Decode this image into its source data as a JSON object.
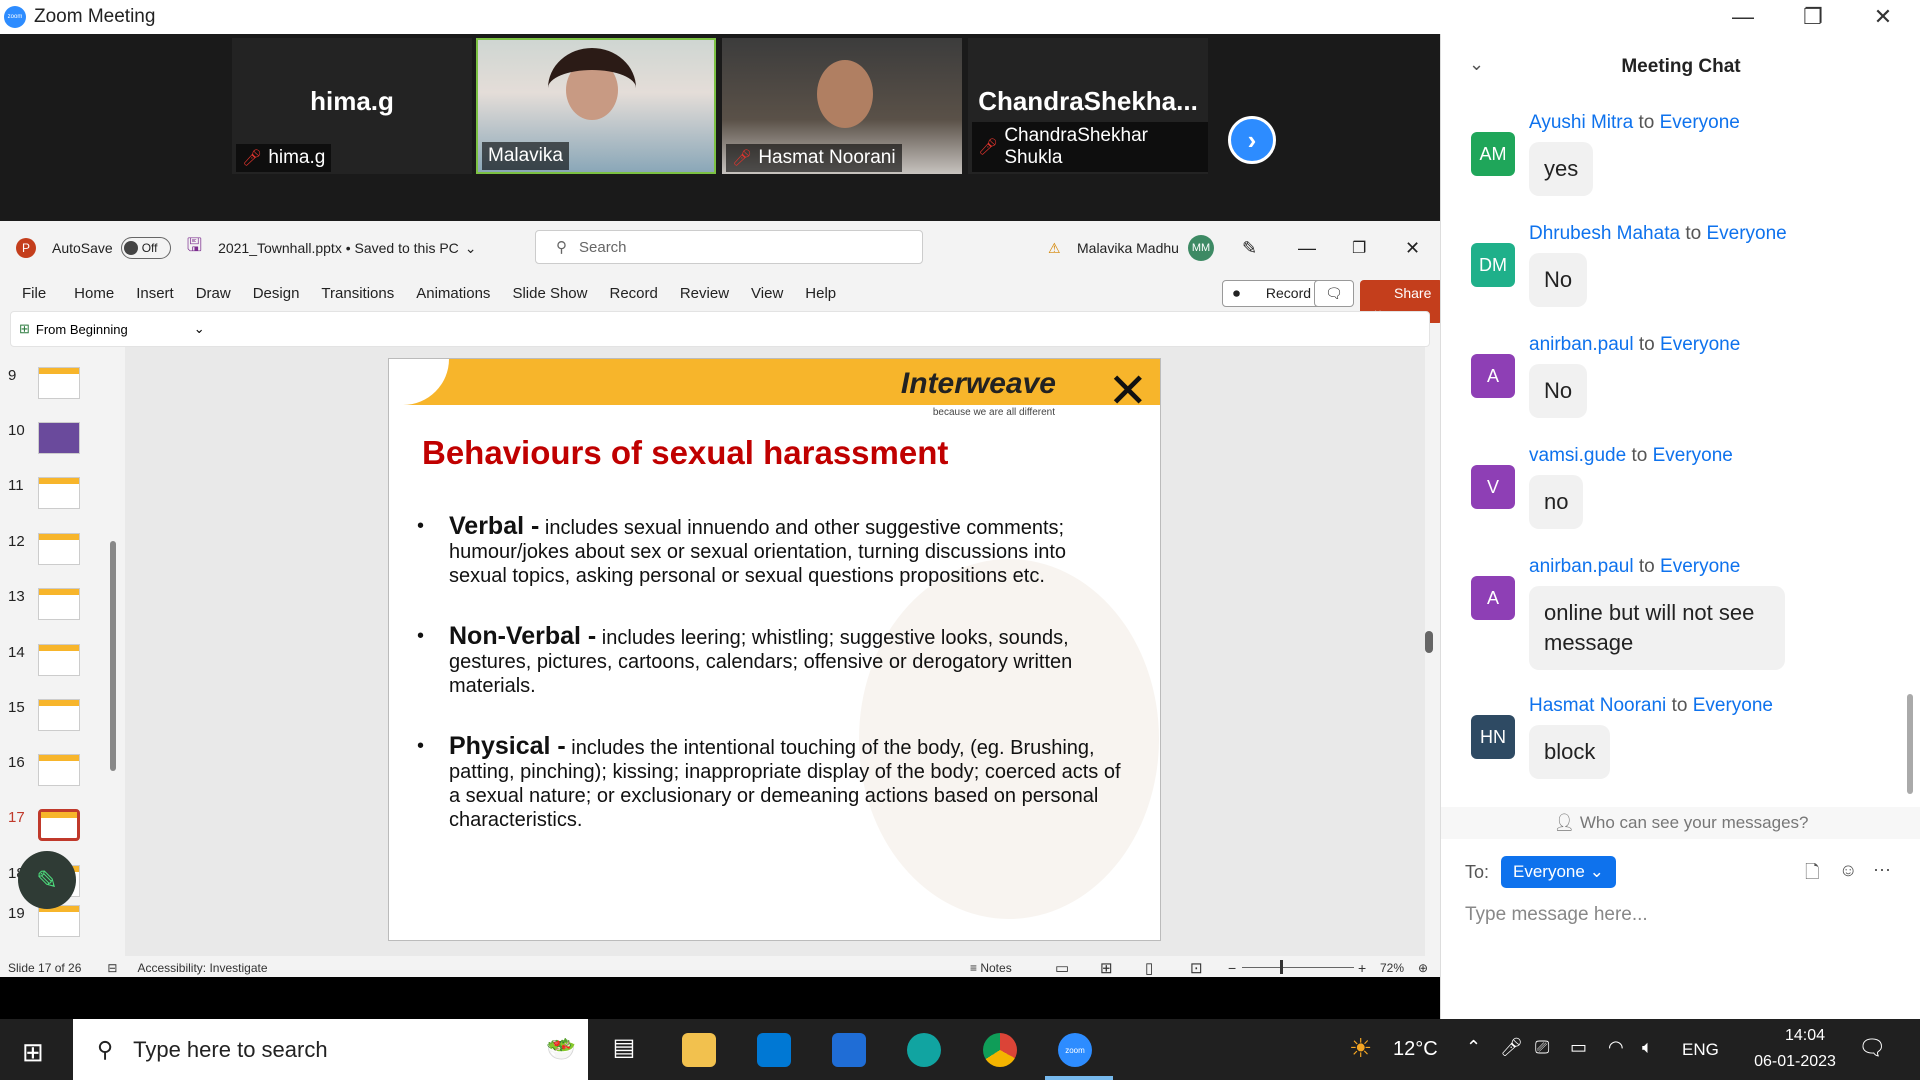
{
  "zoom": {
    "window_title": "Zoom Meeting",
    "participants": [
      {
        "big_name": "hima.g",
        "tag": "hima.g",
        "muted": true
      },
      {
        "big_name": "",
        "tag": "Malavika",
        "muted": false
      },
      {
        "big_name": "",
        "tag": "Hasmat Noorani",
        "muted": true
      },
      {
        "big_name": "ChandraShekha...",
        "tag": "ChandraShekhar Shukla",
        "muted": true
      }
    ]
  },
  "ppt": {
    "autosave_label": "AutoSave",
    "autosave_state": "Off",
    "file_name": "2021_Townhall.pptx • Saved to this PC",
    "search_placeholder": "Search",
    "user_name": "Malavika Madhu",
    "user_initials": "MM",
    "menu": [
      "File",
      "Home",
      "Insert",
      "Draw",
      "Design",
      "Transitions",
      "Animations",
      "Slide Show",
      "Record",
      "Review",
      "View",
      "Help"
    ],
    "record_button": "Record",
    "share_button": "Share",
    "ribbon_from_beginning": "From Beginning",
    "thumbnails": [
      "9",
      "10",
      "11",
      "12",
      "13",
      "14",
      "15",
      "16",
      "17",
      "18",
      "19"
    ],
    "active_slide": "17",
    "status_slide": "Slide 17 of 26",
    "status_accessibility": "Accessibility: Investigate",
    "status_notes": "Notes",
    "zoom_level": "72%",
    "slide": {
      "logo_text": "Interweave",
      "tagline": "because we are all different",
      "title": "Behaviours of sexual harassment",
      "bullets": [
        {
          "term": "Verbal -",
          "text": " includes sexual innuendo and other suggestive comments; humour/jokes about sex or sexual orientation, turning discussions into sexual topics, asking personal or sexual questions propositions etc."
        },
        {
          "term": "Non-Verbal -",
          "text": " includes leering; whistling; suggestive looks, sounds, gestures, pictures, cartoons, calendars; offensive or derogatory written materials."
        },
        {
          "term": "Physical -",
          "text": "  includes the intentional touching of the body, (eg. Brushing, patting, pinching); kissing; inappropriate display of the body; coerced acts of a sexual nature; or exclusionary or demeaning actions based on personal characteristics."
        }
      ]
    }
  },
  "chat": {
    "title": "Meeting Chat",
    "messages": [
      {
        "initials": "AM",
        "color": "#1fa65a",
        "sender": "Ayushi Mitra",
        "to": "to",
        "target": "Everyone",
        "text": "yes"
      },
      {
        "initials": "DM",
        "color": "#1fb08a",
        "sender": "Dhrubesh Mahata",
        "to": "to",
        "target": "Everyone",
        "text": "No"
      },
      {
        "initials": "A",
        "color": "#8e3fb5",
        "sender": "anirban.paul",
        "to": "to",
        "target": "Everyone",
        "text": "No"
      },
      {
        "initials": "V",
        "color": "#8e3fb5",
        "sender": "vamsi.gude",
        "to": "to",
        "target": "Everyone",
        "text": "no"
      },
      {
        "initials": "A",
        "color": "#8e3fb5",
        "sender": "anirban.paul",
        "to": "to",
        "target": "Everyone",
        "text": "online but will not see message"
      },
      {
        "initials": "HN",
        "color": "#2e4a63",
        "sender": "Hasmat Noorani",
        "to": "to",
        "target": "Everyone",
        "text": "block"
      }
    ],
    "who_can_see": "Who can see your messages?",
    "to_label": "To:",
    "to_value": "Everyone",
    "input_placeholder": "Type message here..."
  },
  "taskbar": {
    "search_placeholder": "Type here to search",
    "temperature": "12°C",
    "language": "ENG",
    "time": "14:04",
    "date": "06-01-2023"
  }
}
